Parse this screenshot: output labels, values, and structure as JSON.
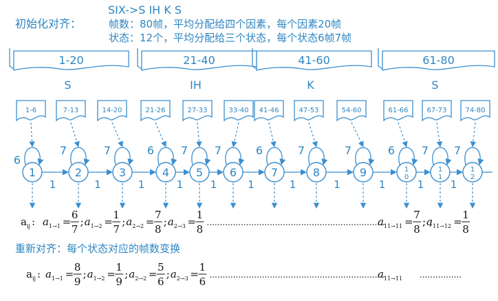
{
  "header": {
    "init_label": "初始化对齐：",
    "phones": "SIX->S  IH  K  S",
    "frames_line": "帧数：80帧，平均分配给四个因素，每个因素20帧",
    "states_line": "状态：12个，平均分配给三个状态，每个状态6帧7帧"
  },
  "phone_ranges": [
    "1-20",
    "21-40",
    "41-60",
    "61-80"
  ],
  "phone_labels": [
    "S",
    "IH",
    "K",
    "S"
  ],
  "frame_boxes": [
    "1-6",
    "7-13",
    "14-20",
    "21-26",
    "27-33",
    "33-40",
    "41-46",
    "47-53",
    "54-60",
    "61-66",
    "67-73",
    "74-80"
  ],
  "states": [
    "1",
    "2",
    "3",
    "4",
    "5",
    "6",
    "7",
    "8",
    "9",
    "10",
    "11",
    "12"
  ],
  "self_loop_labels": [
    "6",
    "7",
    "7",
    "6",
    "7",
    "7",
    "6",
    "7",
    "7",
    "6",
    "7",
    "7"
  ],
  "transition_labels": [
    "1",
    "1",
    "1",
    "1",
    "1",
    "1",
    "1",
    "1",
    "1",
    "1",
    "1"
  ],
  "equation1": {
    "prefix": "a",
    "prefix_sub": "ij",
    "colon": " :",
    "terms": [
      {
        "name": "a",
        "sub": "1→1",
        "num": "6",
        "den": "7"
      },
      {
        "name": "a",
        "sub": "1→2",
        "num": "1",
        "den": "7"
      },
      {
        "name": "a",
        "sub": "2→2",
        "num": "7",
        "den": "8"
      },
      {
        "name": "a",
        "sub": "2→3",
        "num": "1",
        "den": "8"
      }
    ],
    "ellipsis": "....................................................................",
    "tail_terms": [
      {
        "name": "a",
        "sub": "11→11",
        "num": "7",
        "den": "8"
      },
      {
        "name": "a",
        "sub": "11→12",
        "num": "1",
        "den": "8"
      }
    ]
  },
  "realign_label": "重新对齐：每个状态对应的帧数变换",
  "equation2": {
    "prefix": "a",
    "prefix_sub": "ij",
    "colon": " :",
    "terms": [
      {
        "name": "a",
        "sub": "1→1",
        "num": "8",
        "den": "9"
      },
      {
        "name": "a",
        "sub": "1→2",
        "num": "1",
        "den": "9"
      },
      {
        "name": "a",
        "sub": "2→2",
        "num": "5",
        "den": "6"
      },
      {
        "name": "a",
        "sub": "2→3",
        "num": "1",
        "den": "6"
      }
    ],
    "ellipsis": "...................................................................",
    "tail_terms": [
      {
        "name": "a",
        "sub": "11→11",
        "num": "",
        "den": ""
      }
    ],
    "trailing_dots": "................"
  },
  "colors": {
    "accent": "#2e86c1",
    "line": "#3a8fd0",
    "text": "#111111"
  }
}
